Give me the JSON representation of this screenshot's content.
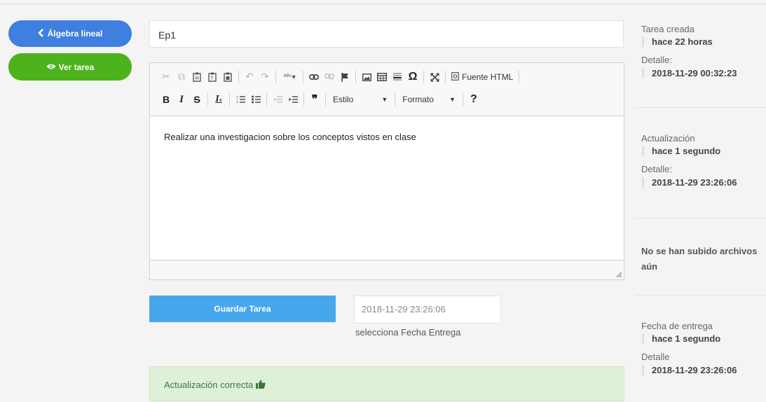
{
  "nav": {
    "back_label": "Álgebra lineal",
    "view_label": "Ver tarea"
  },
  "task": {
    "title_value": "Ep1",
    "content": "Realizar una investigacion sobre los conceptos vistos en clase"
  },
  "toolbar": {
    "source_label": "Fuente HTML",
    "style_label": "Estilo",
    "format_label": "Formato"
  },
  "actions": {
    "save_label": "Guardar Tarea",
    "due_date_value": "2018-11-29 23:26:06",
    "due_date_help": "selecciona Fecha Entrega"
  },
  "alert": {
    "message": "Actualización correcta"
  },
  "sidebar": {
    "created": {
      "label": "Tarea creada",
      "relative": "hace 22 horas",
      "detail_label": "Detalle:",
      "detail": "2018-11-29 00:32:23"
    },
    "updated": {
      "label": "Actualización",
      "relative": "hace 1 segundo",
      "detail_label": "Detalle:",
      "detail": "2018-11-29 23:26:06"
    },
    "files": {
      "message": "No se han subido archivos aún"
    },
    "due": {
      "label": "Fecha de entrega",
      "relative": "hace 1 segundo",
      "detail_label": "Detalle",
      "detail": "2018-11-29 23:26:06"
    }
  },
  "colors": {
    "primary": "#3f7fe0",
    "success": "#4cb31c",
    "save": "#47a7ec",
    "alert_bg": "#dff0d8"
  }
}
